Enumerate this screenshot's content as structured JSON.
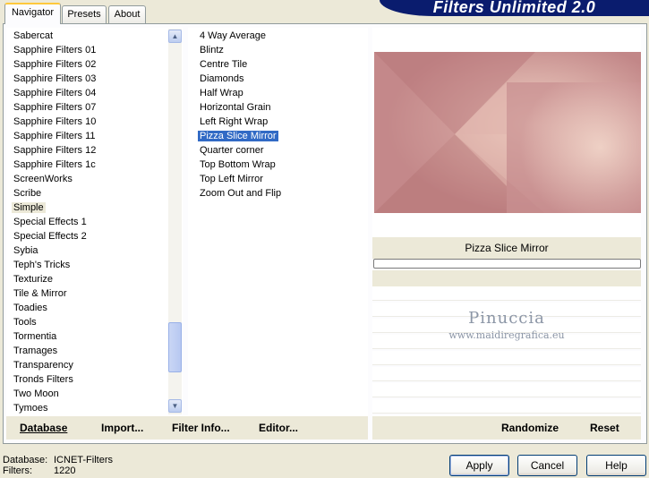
{
  "window": {
    "title": "Filters Unlimited 2.0"
  },
  "tabs": [
    "Navigator",
    "Presets",
    "About"
  ],
  "categories": [
    "Sabercat",
    "Sapphire Filters 01",
    "Sapphire Filters 02",
    "Sapphire Filters 03",
    "Sapphire Filters 04",
    "Sapphire Filters 07",
    "Sapphire Filters 10",
    "Sapphire Filters 11",
    "Sapphire Filters 12",
    "Sapphire Filters 1c",
    "ScreenWorks",
    "Scribe",
    "Simple",
    "Special Effects 1",
    "Special Effects 2",
    "Sybia",
    "Teph's Tricks",
    "Texturize",
    "Tile & Mirror",
    "Toadies",
    "Tools",
    "Tormentia",
    "Tramages",
    "Transparency",
    "Tronds Filters",
    "Two Moon",
    "Tymoes"
  ],
  "selected_category": "Simple",
  "filters": [
    "4 Way Average",
    "Blintz",
    "Centre Tile",
    "Diamonds",
    "Half Wrap",
    "Horizontal Grain",
    "Left Right Wrap",
    "Pizza Slice Mirror",
    "Quarter corner",
    "Top Bottom Wrap",
    "Top Left Mirror",
    "Zoom Out and Flip"
  ],
  "selected_filter": "Pizza Slice Mirror",
  "bottom_left": {
    "database": "Database",
    "import": "Import...",
    "filter_info": "Filter Info...",
    "editor": "Editor..."
  },
  "bottom_right": {
    "randomize": "Randomize",
    "reset": "Reset"
  },
  "preview": {
    "filter_name": "Pizza Slice Mirror"
  },
  "watermark": {
    "title": "Pinuccia",
    "site": "www.maidiregrafica.eu"
  },
  "status": {
    "database_label": "Database:",
    "database_value": "ICNET-Filters",
    "filters_label": "Filters:",
    "filters_value": "1220"
  },
  "buttons": {
    "apply": "Apply",
    "cancel": "Cancel",
    "help": "Help"
  },
  "icons": {
    "scroll_up": "chevron-up-icon",
    "scroll_down": "chevron-down-icon"
  },
  "colors": {
    "title_bg": "#0a1c6e",
    "selection": "#316ac5",
    "preview_base": "#c99596"
  }
}
